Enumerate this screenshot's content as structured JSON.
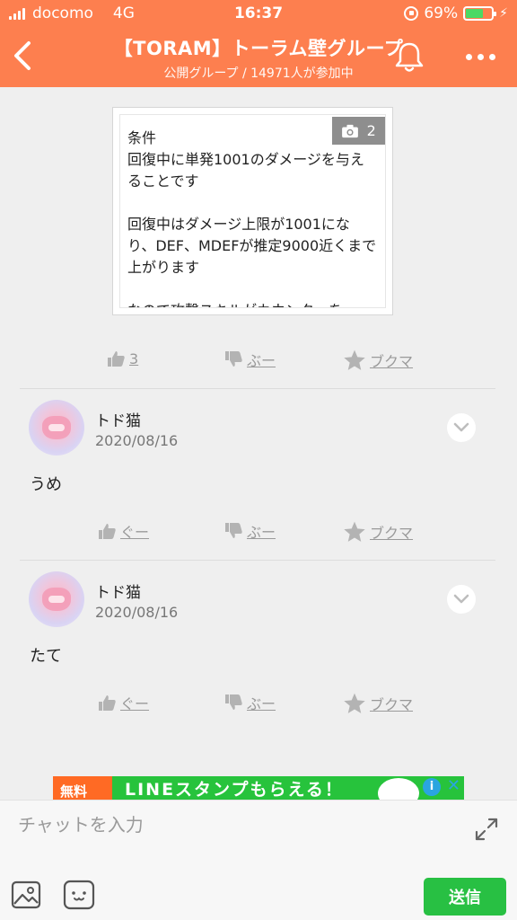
{
  "status_bar": {
    "carrier": "docomo",
    "network": "4G",
    "time": "16:37",
    "battery": "69%",
    "battery_level": 0.69
  },
  "header": {
    "title": "【TORAM】トーラム壁グループ",
    "subtitle": "公開グループ / 14971人が参加中"
  },
  "post": {
    "image_text": "条件\n回復中に単発1001のダメージを与えることです\n\n回復中はダメージ上限が1001になり、DEF、MDEFが推定9000近くまで上がります\n\nなので攻撃スキルがカウンターを",
    "photo_count": "2",
    "reactions": {
      "good": "3",
      "boo": "ぶー",
      "bookmark": "ブクマ"
    }
  },
  "comments": [
    {
      "name": "トド猫",
      "date": "2020/08/16",
      "body": "うめ",
      "reactions": {
        "good": "ぐー",
        "boo": "ぶー",
        "bookmark": "ブクマ"
      }
    },
    {
      "name": "トド猫",
      "date": "2020/08/16",
      "body": "たて",
      "reactions": {
        "good": "ぐー",
        "boo": "ぶー",
        "bookmark": "ブクマ"
      }
    }
  ],
  "ad": {
    "tag": "無料",
    "text": "LINEスタンプもらえる！"
  },
  "input": {
    "placeholder": "チャットを入力",
    "send_label": "送信"
  },
  "colors": {
    "header": "#fd7f4f",
    "send": "#28c043",
    "ad": "#27c33c"
  }
}
